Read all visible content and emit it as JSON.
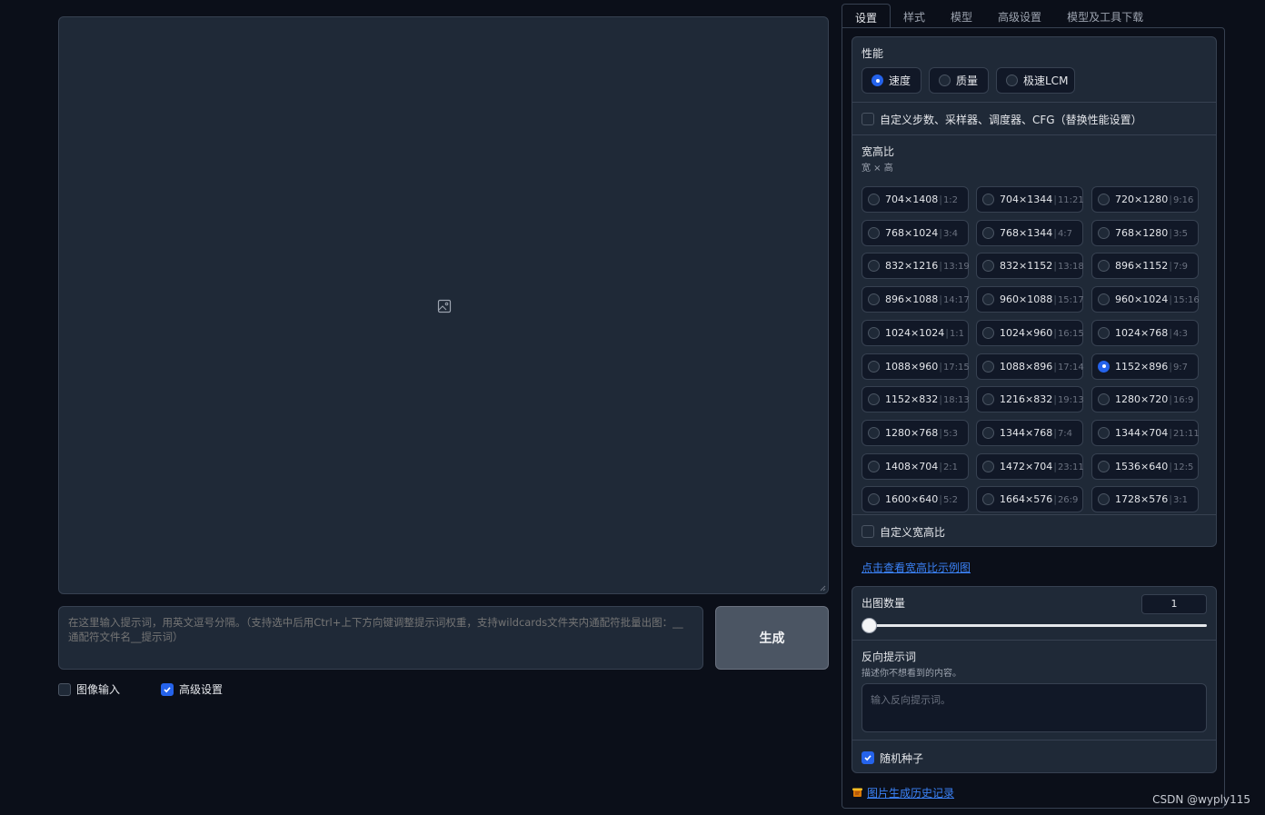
{
  "left": {
    "prompt_placeholder": "在这里输入提示词，用英文逗号分隔。（支持选中后用Ctrl+上下方向键调整提示词权重，支持wildcards文件夹内通配符批量出图：__通配符文件名__提示词）",
    "generate_label": "生成",
    "image_input_label": "图像输入",
    "advanced_label": "高级设置",
    "image_input_checked": false,
    "advanced_checked": true
  },
  "tabs": [
    "设置",
    "样式",
    "模型",
    "高级设置",
    "模型及工具下载"
  ],
  "performance": {
    "label": "性能",
    "options": [
      "速度",
      "质量",
      "极速LCM"
    ],
    "selected": "速度"
  },
  "custom_steps_label": "自定义步数、采样器、调度器、CFG（替换性能设置）",
  "aspect": {
    "label": "宽高比",
    "hint": "宽 × 高",
    "selected": "1152×896",
    "options": [
      {
        "size": "704×1408",
        "ratio": "1:2"
      },
      {
        "size": "704×1344",
        "ratio": "11:21"
      },
      {
        "size": "720×1280",
        "ratio": "9:16"
      },
      {
        "size": "768×1024",
        "ratio": "3:4"
      },
      {
        "size": "768×1344",
        "ratio": "4:7"
      },
      {
        "size": "768×1280",
        "ratio": "3:5"
      },
      {
        "size": "832×1216",
        "ratio": "13:19"
      },
      {
        "size": "832×1152",
        "ratio": "13:18"
      },
      {
        "size": "896×1152",
        "ratio": "7:9"
      },
      {
        "size": "896×1088",
        "ratio": "14:17"
      },
      {
        "size": "960×1088",
        "ratio": "15:17"
      },
      {
        "size": "960×1024",
        "ratio": "15:16"
      },
      {
        "size": "1024×1024",
        "ratio": "1:1"
      },
      {
        "size": "1024×960",
        "ratio": "16:15"
      },
      {
        "size": "1024×768",
        "ratio": "4:3"
      },
      {
        "size": "1088×960",
        "ratio": "17:15"
      },
      {
        "size": "1088×896",
        "ratio": "17:14"
      },
      {
        "size": "1152×896",
        "ratio": "9:7"
      },
      {
        "size": "1152×832",
        "ratio": "18:13"
      },
      {
        "size": "1216×832",
        "ratio": "19:13"
      },
      {
        "size": "1280×720",
        "ratio": "16:9"
      },
      {
        "size": "1280×768",
        "ratio": "5:3"
      },
      {
        "size": "1344×768",
        "ratio": "7:4"
      },
      {
        "size": "1344×704",
        "ratio": "21:11"
      },
      {
        "size": "1408×704",
        "ratio": "2:1"
      },
      {
        "size": "1472×704",
        "ratio": "23:11"
      },
      {
        "size": "1536×640",
        "ratio": "12:5"
      },
      {
        "size": "1600×640",
        "ratio": "5:2"
      },
      {
        "size": "1664×576",
        "ratio": "26:9"
      },
      {
        "size": "1728×576",
        "ratio": "3:1"
      }
    ]
  },
  "custom_aspect_label": "自定义宽高比",
  "aspect_example_link": "点击查看宽高比示例图",
  "image_count": {
    "label": "出图数量",
    "value": "1"
  },
  "negative": {
    "label": "反向提示词",
    "hint": "描述你不想看到的内容。",
    "placeholder": "输入反向提示词。"
  },
  "random_seed_label": "随机种子",
  "history_link": "图片生成历史记录",
  "watermark": "CSDN @wyply115",
  "colors": {
    "accent": "#2563eb",
    "link": "#3b82f6",
    "background": "#0b0f19",
    "panel": "#1f2937"
  }
}
